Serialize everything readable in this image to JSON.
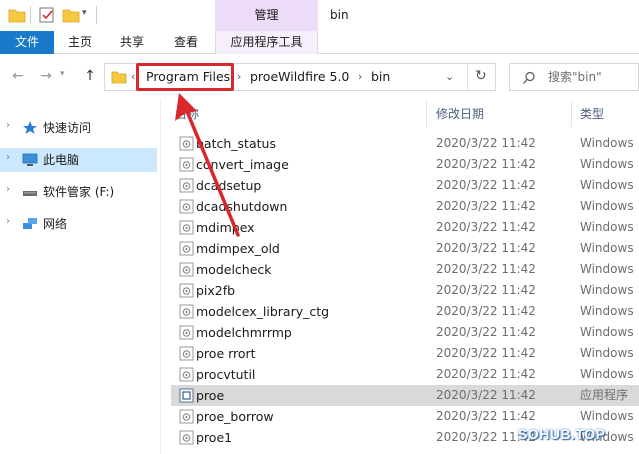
{
  "titlebar": {
    "contextual_tab": "管理",
    "window_title": "bin"
  },
  "ribbon": {
    "tabs": [
      {
        "label": "文件"
      },
      {
        "label": "主页"
      },
      {
        "label": "共享"
      },
      {
        "label": "查看"
      },
      {
        "label": "应用程序工具"
      }
    ]
  },
  "address": {
    "crumbs": [
      "Program Files",
      "proeWildfire 5.0",
      "bin"
    ],
    "search_placeholder": "搜索\"bin\""
  },
  "nav": {
    "items": [
      {
        "label": "快速访问",
        "icon": "star-icon"
      },
      {
        "label": "此电脑",
        "icon": "monitor-icon",
        "selected": true
      },
      {
        "label": "软件管家 (F:)",
        "icon": "drive-icon"
      },
      {
        "label": "网络",
        "icon": "network-icon"
      }
    ]
  },
  "columns": {
    "name": "名称",
    "date": "修改日期",
    "type": "类型"
  },
  "files": [
    {
      "name": "batch_status",
      "date": "2020/3/22 11:42",
      "type": "Windows"
    },
    {
      "name": "convert_image",
      "date": "2020/3/22 11:42",
      "type": "Windows"
    },
    {
      "name": "dcadsetup",
      "date": "2020/3/22 11:42",
      "type": "Windows"
    },
    {
      "name": "dcadshutdown",
      "date": "2020/3/22 11:42",
      "type": "Windows"
    },
    {
      "name": "mdimpex",
      "date": "2020/3/22 11:42",
      "type": "Windows"
    },
    {
      "name": "mdimpex_old",
      "date": "2020/3/22 11:42",
      "type": "Windows"
    },
    {
      "name": "modelcheck",
      "date": "2020/3/22 11:42",
      "type": "Windows"
    },
    {
      "name": "pix2fb",
      "date": "2020/3/22 11:42",
      "type": "Windows"
    },
    {
      "name": "modelcex_library_ctg",
      "date": "2020/3/22 11:42",
      "type": "Windows"
    },
    {
      "name": "modelchmrrmp",
      "date": "2020/3/22 11:42",
      "type": "Windows"
    },
    {
      "name": "proe  rrort",
      "date": "2020/3/22 11:42",
      "type": "Windows"
    },
    {
      "name": "procvtutil",
      "date": "2020/3/22 11:42",
      "type": "Windows"
    },
    {
      "name": "proe",
      "date": "2020/3/22 11:42",
      "type": "应用程序",
      "selected": true
    },
    {
      "name": "proe_borrow",
      "date": "2020/3/22 11:42",
      "type": "Windows"
    },
    {
      "name": "proe1",
      "date": "2020/3/22 11:42",
      "type": "Windows"
    }
  ],
  "watermark": "SOHUB.TOP",
  "colors": {
    "file_tab": "#1979ca",
    "contextual_tab": "#eddcf7",
    "nav_selected": "#cce8ff",
    "row_selected": "#d9d9d9",
    "annotation": "#d9272e"
  }
}
